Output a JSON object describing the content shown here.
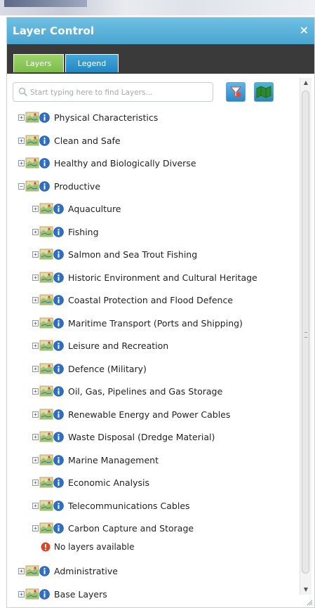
{
  "window": {
    "title": "Layer Control",
    "close_label": "×"
  },
  "tabs": [
    {
      "label": "Layers",
      "active": true
    },
    {
      "label": "Legend",
      "active": false
    }
  ],
  "search": {
    "placeholder": "Start typing here to find Layers...",
    "value": ""
  },
  "tree": {
    "top_groups": [
      {
        "label": "Physical Characteristics",
        "expanded": false
      },
      {
        "label": "Clean and Safe",
        "expanded": false
      },
      {
        "label": "Healthy and Biologically Diverse",
        "expanded": false
      },
      {
        "label": "Productive",
        "expanded": true
      }
    ],
    "productive_children": [
      {
        "label": "Aquaculture"
      },
      {
        "label": "Fishing"
      },
      {
        "label": "Salmon and Sea Trout Fishing"
      },
      {
        "label": "Historic Environment and Cultural Heritage"
      },
      {
        "label": "Coastal Protection and Flood Defence"
      },
      {
        "label": "Maritime Transport (Ports and Shipping)"
      },
      {
        "label": "Leisure and Recreation"
      },
      {
        "label": "Defence (Military)"
      },
      {
        "label": "Oil, Gas, Pipelines and Gas Storage"
      },
      {
        "label": "Renewable Energy and Power Cables"
      },
      {
        "label": "Waste Disposal (Dredge Material)"
      },
      {
        "label": "Marine Management"
      },
      {
        "label": "Economic Analysis"
      },
      {
        "label": "Telecommunications Cables"
      },
      {
        "label": "Carbon Capture and Storage"
      }
    ],
    "empty_message": "No layers available",
    "bottom_groups": [
      {
        "label": "Administrative",
        "expanded": false
      },
      {
        "label": "Base Layers",
        "expanded": false
      }
    ]
  },
  "colors": {
    "titlebar": "#4aa5d1",
    "tab_layers": "#7dbd4a",
    "tab_legend": "#2288c2",
    "info_icon": "#2e6fc4",
    "warning_icon": "#d9472b"
  },
  "icons": {
    "layer": "layer-map-icon",
    "info": "info-icon",
    "warning": "warning-icon",
    "search": "search-icon",
    "filter": "filter-icon",
    "map": "map-icon"
  }
}
